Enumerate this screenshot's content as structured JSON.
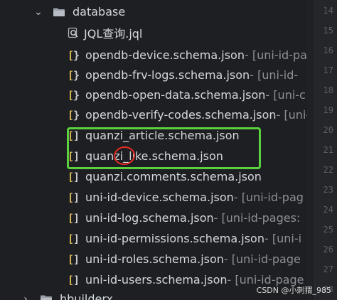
{
  "explorer": {
    "folder": {
      "label": "database",
      "expanded": true
    },
    "query_file": {
      "label": "JQL查询.jql",
      "icon": "jql-icon"
    },
    "files": [
      {
        "label": "opendb-device.schema.json",
        "meta": " - [uni-id-pa"
      },
      {
        "label": "opendb-frv-logs.schema.json",
        "meta": " - [uni-id-"
      },
      {
        "label": "opendb-open-data.schema.json",
        "meta": " - [uni-c"
      },
      {
        "label": "opendb-verify-codes.schema.json",
        "meta": " - [uni-"
      },
      {
        "label": "quanzi_article.schema.json",
        "meta": ""
      },
      {
        "label": "quanzi_like.schema.json",
        "meta": ""
      },
      {
        "label": "quanzi.comments.schema.json",
        "meta": ""
      },
      {
        "label": "uni-id-device.schema.json",
        "meta": " - [uni-id-pag"
      },
      {
        "label": "uni-id-log.schema.json",
        "meta": " - [uni-id-pages:"
      },
      {
        "label": "uni-id-permissions.schema.json",
        "meta": " - [uni-i"
      },
      {
        "label": "uni-id-roles.schema.json",
        "meta": " - [uni-id-page"
      },
      {
        "label": "uni-id-users.schema.json",
        "meta": " - [uni-id-page"
      }
    ],
    "next_folder": {
      "label": "hbuilderx"
    }
  },
  "gutter": {
    "line_numbers": [
      "14",
      "15",
      "16",
      "17",
      "18",
      "19",
      "20",
      "21",
      "22",
      "23",
      "24",
      "25",
      "26",
      "27",
      "28"
    ]
  },
  "annotations": {
    "highlight_color": "#59d23d",
    "circle_color": "#e22b22"
  },
  "watermark": {
    "text": "CSDN @小刺猬_985"
  },
  "colors": {
    "background": "#1e1f22",
    "text": "#d4d7db",
    "meta_text": "#8c9097"
  }
}
